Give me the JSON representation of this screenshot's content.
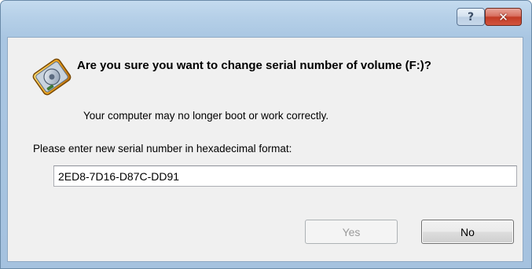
{
  "dialog": {
    "help_glyph": "?",
    "close_glyph": "✕",
    "icon": "disk-volume-icon",
    "question": "Are you sure you want to change serial number of volume (F:)?",
    "warning": "Your computer may no longer boot or work correctly.",
    "prompt": "Please enter new serial number in hexadecimal format:",
    "serial_value": "2ED8-7D16-D87C-DD91",
    "yes_label": "Yes",
    "no_label": "No",
    "yes_enabled": false
  },
  "colors": {
    "titlebar": "#b6d0e8",
    "close_button": "#c23b25",
    "client_background": "#f0f0f0",
    "disabled_text": "#9a9a9a"
  }
}
